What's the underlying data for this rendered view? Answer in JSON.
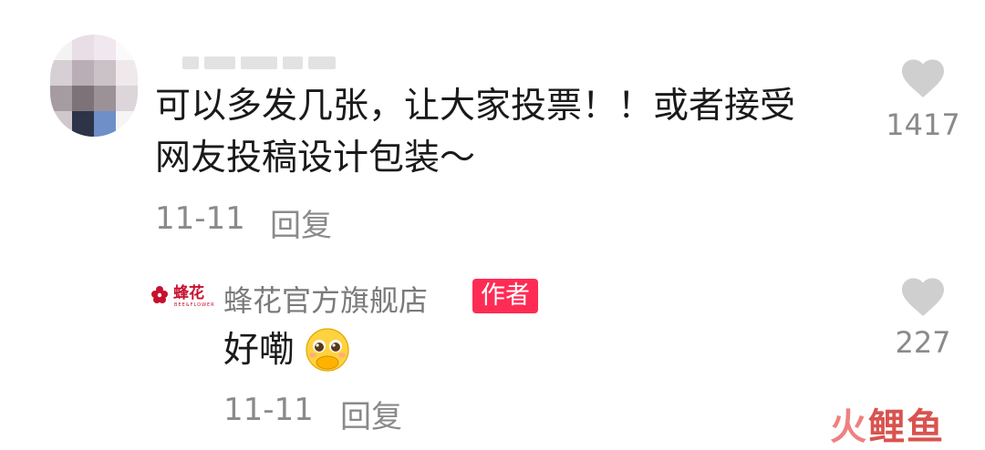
{
  "comment1": {
    "text_line1": "可以多发几张，让大家投票！！或者接受",
    "text_line2": "网友投稿设计包装～",
    "date": "11-11",
    "reply_label": "回复",
    "like_count": "1417"
  },
  "comment2": {
    "author": "蜂花官方旗舰店",
    "author_badge": "作者",
    "logo_text": "蜂花",
    "logo_subtext": "BEE&FLOWER",
    "text": "好嘞",
    "date": "11-11",
    "reply_label": "回复",
    "like_count": "227"
  },
  "watermark": {
    "part1": "火",
    "part2": "鲤鱼"
  },
  "colors": {
    "author_badge_bg": "#fe2c55",
    "watermark_part1": "#f08080",
    "watermark_part2": "#d9534f"
  }
}
